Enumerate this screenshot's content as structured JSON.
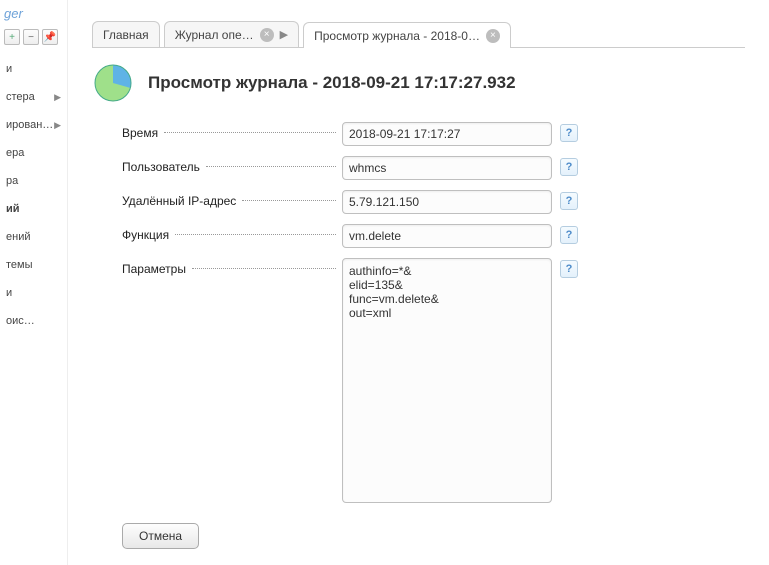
{
  "brand_fragment": "ger",
  "sidebar": {
    "items": [
      {
        "label": "и"
      },
      {
        "label": "стера",
        "arrow": true
      },
      {
        "label": "ирован…",
        "arrow": true
      },
      {
        "label": "ера"
      },
      {
        "label": "ра"
      },
      {
        "label": "ий",
        "active": true
      },
      {
        "label": "ений"
      },
      {
        "label": "темы"
      },
      {
        "label": "и"
      },
      {
        "label": "оис…"
      }
    ]
  },
  "tabs": [
    {
      "label": "Главная"
    },
    {
      "label": "Журнал опе…",
      "closable": true,
      "arrow": true
    },
    {
      "label": "Просмотр журнала - 2018-0…",
      "closable": true,
      "active": true
    }
  ],
  "header": {
    "title": "Просмотр журнала - 2018-09-21 17:17:27.932"
  },
  "form": {
    "time": {
      "label": "Время",
      "value": "2018-09-21 17:17:27"
    },
    "user": {
      "label": "Пользователь",
      "value": "whmcs"
    },
    "ip": {
      "label": "Удалённый IP-адрес",
      "value": "5.79.121.150"
    },
    "func": {
      "label": "Функция",
      "value": "vm.delete"
    },
    "params": {
      "label": "Параметры",
      "value": "authinfo=*&\nelid=135&\nfunc=vm.delete&\nout=xml"
    }
  },
  "buttons": {
    "cancel": "Отмена"
  }
}
